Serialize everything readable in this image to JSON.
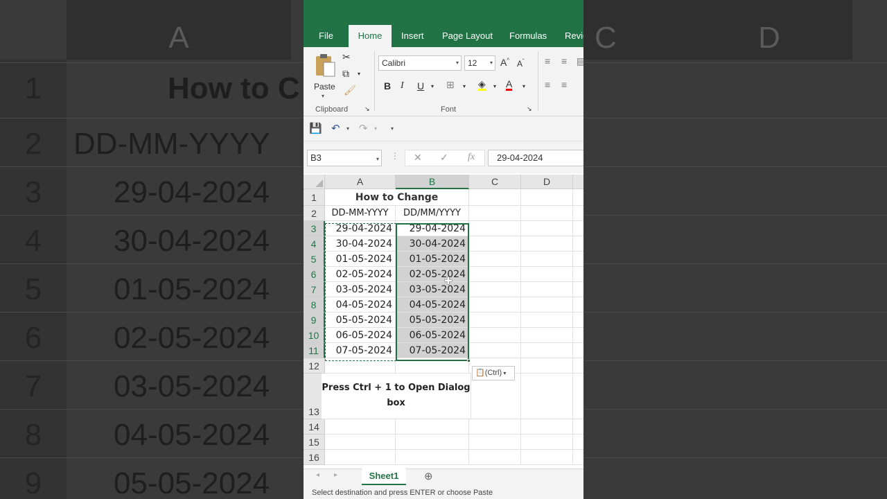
{
  "background": {
    "col_headers": [
      "A",
      "C",
      "D"
    ],
    "row_numbers": [
      "1",
      "2",
      "3",
      "4",
      "5",
      "6",
      "7",
      "8",
      "9"
    ],
    "cells": [
      "How to C",
      "DD-MM-YYYY",
      "29-04-2024",
      "30-04-2024",
      "01-05-2024",
      "02-05-2024",
      "03-05-2024",
      "04-05-2024",
      "05-05-2024"
    ]
  },
  "ribbon_tabs": [
    "File",
    "Home",
    "Insert",
    "Page Layout",
    "Formulas",
    "Revie"
  ],
  "clipboard": {
    "paste_label": "Paste",
    "group_label": "Clipboard"
  },
  "font": {
    "name": "Calibri",
    "size": "12",
    "group_label": "Font"
  },
  "namebox": "B3",
  "formula_value": "29-04-2024",
  "columns": [
    "A",
    "B",
    "C",
    "D"
  ],
  "rows": [
    {
      "num": "1",
      "a": "How to Change",
      "b": ""
    },
    {
      "num": "2",
      "a": "DD-MM-YYYY",
      "b": "DD/MM/YYYY"
    },
    {
      "num": "3",
      "a": "29-04-2024",
      "b": "29-04-2024"
    },
    {
      "num": "4",
      "a": "30-04-2024",
      "b": "30-04-2024"
    },
    {
      "num": "5",
      "a": "01-05-2024",
      "b": "01-05-2024"
    },
    {
      "num": "6",
      "a": "02-05-2024",
      "b": "02-05-2024"
    },
    {
      "num": "7",
      "a": "03-05-2024",
      "b": "03-05-2024"
    },
    {
      "num": "8",
      "a": "04-05-2024",
      "b": "04-05-2024"
    },
    {
      "num": "9",
      "a": "05-05-2024",
      "b": "05-05-2024"
    },
    {
      "num": "10",
      "a": "06-05-2024",
      "b": "06-05-2024"
    },
    {
      "num": "11",
      "a": "07-05-2024",
      "b": "07-05-2024"
    },
    {
      "num": "12",
      "a": "",
      "b": ""
    },
    {
      "num": "13",
      "a": "Press Ctrl + 1 to Open Dialog box",
      "b": ""
    },
    {
      "num": "14",
      "a": "",
      "b": ""
    },
    {
      "num": "15",
      "a": "",
      "b": ""
    },
    {
      "num": "16",
      "a": "",
      "b": ""
    }
  ],
  "paste_options_label": "(Ctrl)",
  "sheet_tab": "Sheet1",
  "status_text": "Select destination and press ENTER or choose Paste",
  "colors": {
    "excel_green": "#217346",
    "selection_gray": "#d2d2d2"
  }
}
